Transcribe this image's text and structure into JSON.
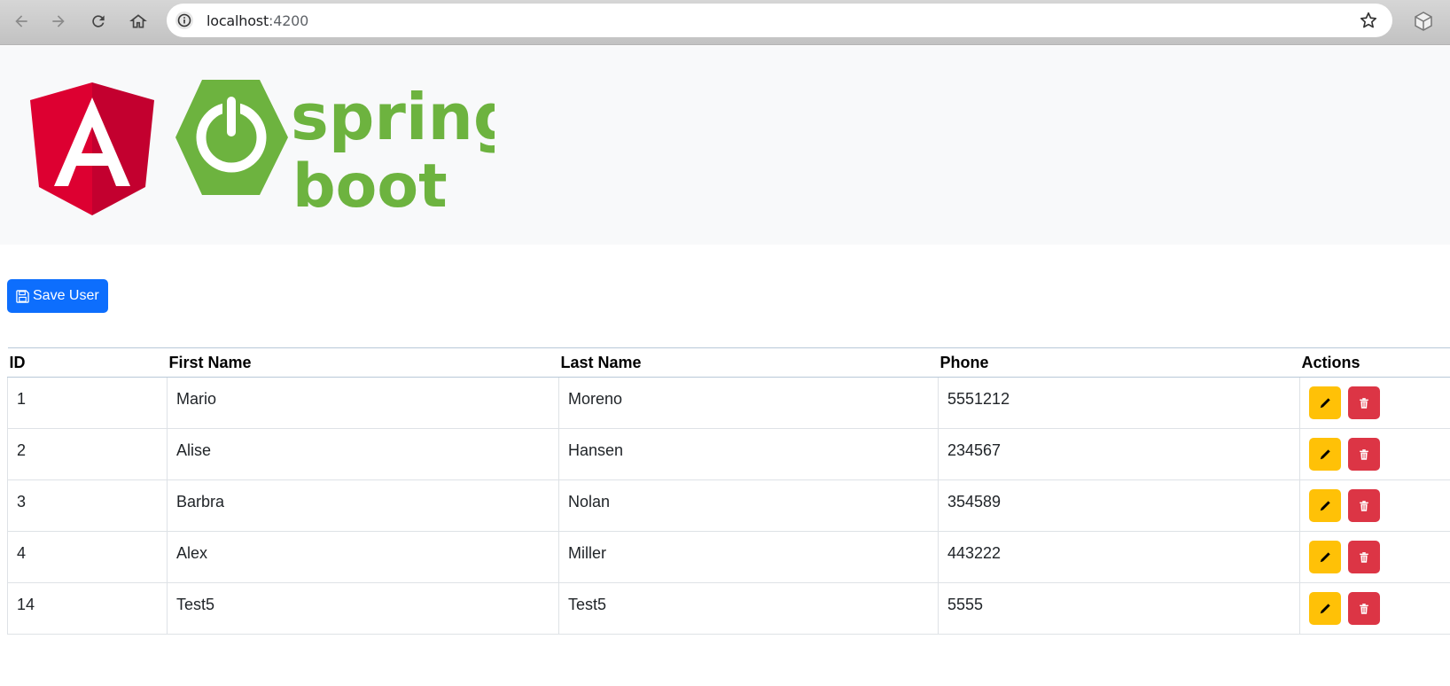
{
  "browser": {
    "url_host": "localhost",
    "url_port": ":4200"
  },
  "header": {
    "logos": [
      "angular-logo",
      "spring-boot-logo"
    ],
    "spring_line1": "spring",
    "spring_line2": "boot",
    "angular_letter": "A"
  },
  "toolbar": {
    "save_label": "Save User",
    "save_icon": "floppy-disk-icon"
  },
  "table": {
    "columns": [
      "ID",
      "First Name",
      "Last Name",
      "Phone",
      "Actions"
    ],
    "rows": [
      {
        "id": "1",
        "first": "Mario",
        "last": "Moreno",
        "phone": "5551212"
      },
      {
        "id": "2",
        "first": "Alise",
        "last": "Hansen",
        "phone": "234567"
      },
      {
        "id": "3",
        "first": "Barbra",
        "last": "Nolan",
        "phone": "354589"
      },
      {
        "id": "4",
        "first": "Alex",
        "last": "Miller",
        "phone": "443222"
      },
      {
        "id": "14",
        "first": "Test5",
        "last": "Test5",
        "phone": "5555"
      }
    ],
    "row_actions": [
      "edit-icon",
      "trash-icon"
    ]
  },
  "colors": {
    "primary": "#0d6efd",
    "warning": "#ffc107",
    "danger": "#dc3545",
    "angular_red": "#dd0031",
    "spring_green": "#6db33f"
  }
}
